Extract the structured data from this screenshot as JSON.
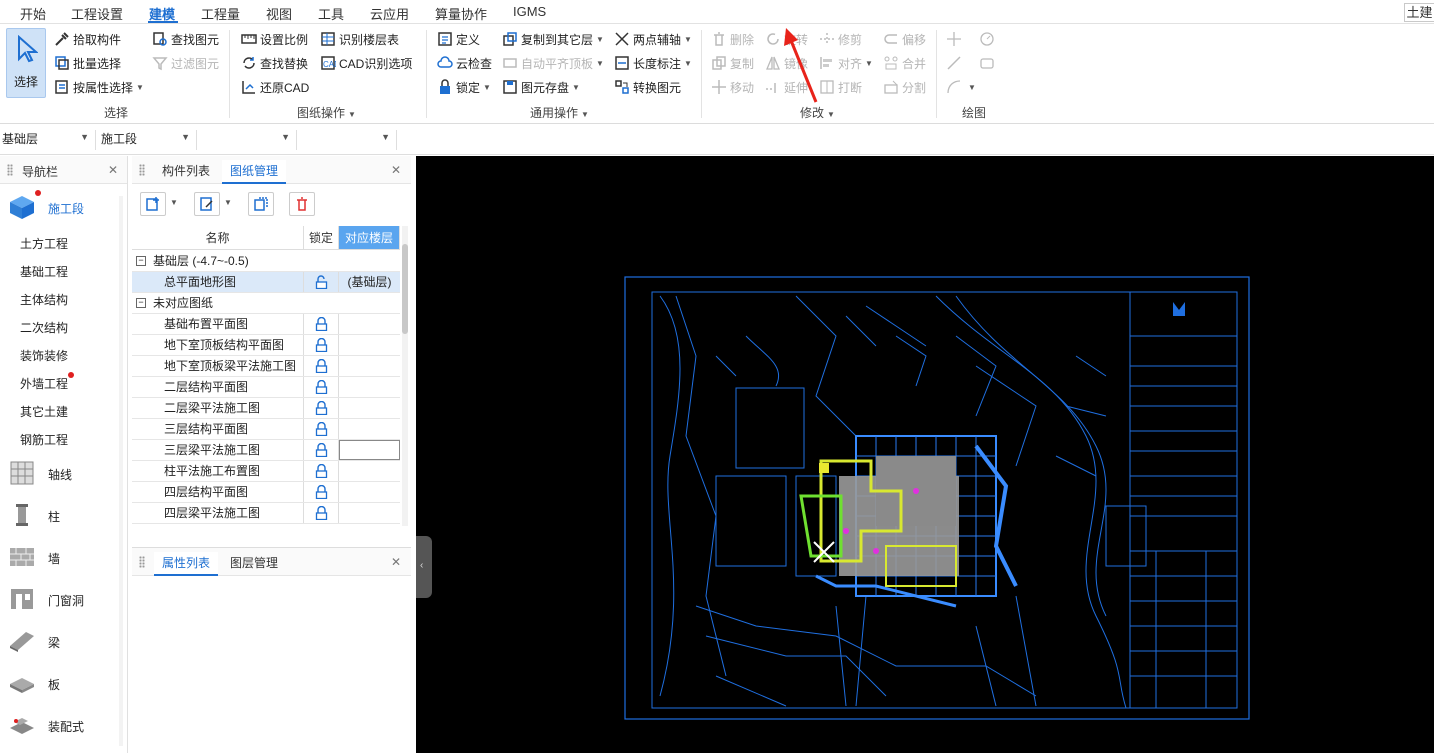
{
  "menu": {
    "items": [
      "开始",
      "工程设置",
      "建模",
      "工程量",
      "视图",
      "工具",
      "云应用",
      "算量协作",
      "IGMS"
    ],
    "active_index": 2,
    "right_tab": "土建"
  },
  "ribbon": {
    "select_group": {
      "big_button": "选择",
      "pick": "拾取构件",
      "batch": "批量选择",
      "by_attr": "按属性选择",
      "find": "查找图元",
      "filter": "过滤图元",
      "label": "选择"
    },
    "drawing_group": {
      "set_scale": "设置比例",
      "identify_floor": "识别楼层表",
      "find_replace": "查找替换",
      "cad_identify": "CAD识别选项",
      "restore_cad": "还原CAD",
      "label": "图纸操作"
    },
    "general_group": {
      "define": "定义",
      "copy_other": "复制到其它层",
      "two_point_axis": "两点辅轴",
      "cloud_check": "云检查",
      "auto_flat": "自动平齐顶板",
      "length_dim": "长度标注",
      "lock": "锁定",
      "element_save": "图元存盘",
      "convert": "转换图元",
      "label": "通用操作"
    },
    "modify_group": {
      "delete": "删除",
      "rotate": "旋转",
      "trim": "修剪",
      "offset": "偏移",
      "copy": "复制",
      "mirror": "镜像",
      "align": "对齐",
      "merge": "合并",
      "move": "移动",
      "extend": "延伸",
      "break": "打断",
      "split": "分割",
      "label": "修改"
    },
    "draw_group": {
      "label": "绘图"
    }
  },
  "floorbar": {
    "floor": "基础层",
    "stage": "施工段"
  },
  "nav": {
    "title": "导航栏",
    "active": "施工段",
    "sub_items": [
      "土方工程",
      "基础工程",
      "主体结构",
      "二次结构",
      "装饰装修",
      "外墙工程",
      "其它土建",
      "钢筋工程"
    ],
    "icon_items": [
      "轴线",
      "柱",
      "墙",
      "门窗洞",
      "梁",
      "板",
      "装配式"
    ]
  },
  "component_panel": {
    "tabs": [
      "构件列表",
      "图纸管理"
    ],
    "active_tab": "图纸管理",
    "columns": [
      "名称",
      "锁定",
      "对应楼层"
    ],
    "rows": [
      {
        "name": "基础层 (-4.7~-0.5)",
        "group": true,
        "lock": false,
        "floor": ""
      },
      {
        "name": "总平面地形图",
        "group": false,
        "lock": true,
        "unlocked": true,
        "floor": "(基础层)",
        "selected": true
      },
      {
        "name": "未对应图纸",
        "group": true,
        "lock": false,
        "floor": ""
      },
      {
        "name": "基础布置平面图",
        "group": false,
        "lock": true,
        "floor": ""
      },
      {
        "name": "地下室顶板结构平面图",
        "group": false,
        "lock": true,
        "floor": ""
      },
      {
        "name": "地下室顶板梁平法施工图",
        "group": false,
        "lock": true,
        "floor": ""
      },
      {
        "name": "二层结构平面图",
        "group": false,
        "lock": true,
        "floor": ""
      },
      {
        "name": "二层梁平法施工图",
        "group": false,
        "lock": true,
        "floor": ""
      },
      {
        "name": "三层结构平面图",
        "group": false,
        "lock": true,
        "floor": ""
      },
      {
        "name": "三层梁平法施工图",
        "group": false,
        "lock": true,
        "floor": "",
        "editing": true
      },
      {
        "name": "柱平法施工布置图",
        "group": false,
        "lock": true,
        "floor": ""
      },
      {
        "name": "四层结构平面图",
        "group": false,
        "lock": true,
        "floor": ""
      },
      {
        "name": "四层梁平法施工图",
        "group": false,
        "lock": true,
        "floor": ""
      }
    ]
  },
  "property_panel": {
    "tabs": [
      "属性列表",
      "图层管理"
    ],
    "active_tab": "属性列表"
  },
  "colors": {
    "accent": "#1e6fd1",
    "cad_blue": "#1f6fe0",
    "cad_yellow": "#d8e830",
    "cad_green": "#6fe030",
    "red_arrow": "#e8231a"
  }
}
